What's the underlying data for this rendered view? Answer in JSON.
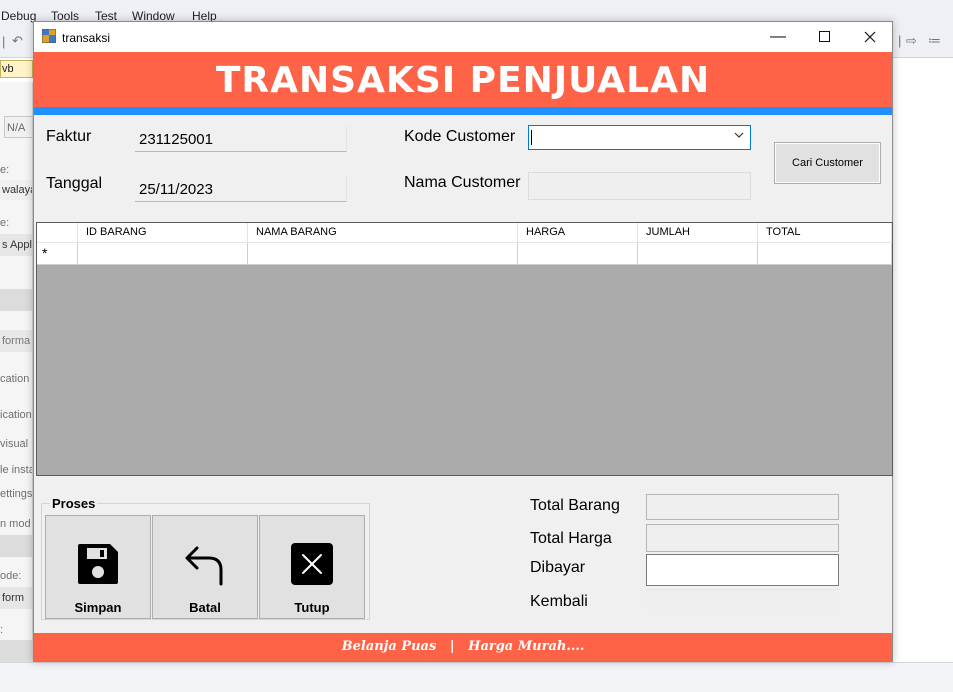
{
  "ide": {
    "menus": [
      "Debug",
      "Tools",
      "Test",
      "Window",
      "Help"
    ],
    "tab_label": "vb",
    "left_panel": {
      "na_text": "N/A",
      "label_1": "e:",
      "value_1": "walaya",
      "label_2": "e:",
      "value_2": "s Appl",
      "section": "forma",
      "item_1": "cation",
      "item_2": "ication",
      "item_3": "visual",
      "item_4": "le insta",
      "item_5": "ettings",
      "item_6": "n mod",
      "label_3": "ode:",
      "value_3": "form",
      "label_4": ":"
    }
  },
  "window": {
    "title": "transaksi",
    "header": "TRANSAKSI PENJUALAN",
    "labels": {
      "faktur": "Faktur",
      "tanggal": "Tanggal",
      "kode_customer": "Kode Customer",
      "nama_customer": "Nama Customer"
    },
    "values": {
      "faktur": "231125001",
      "tanggal": "25/11/2023",
      "kode_customer": "",
      "nama_customer": ""
    },
    "cari_button": "Cari Customer",
    "grid": {
      "columns": [
        "ID BARANG",
        "NAMA BARANG",
        "HARGA",
        "JUMLAH",
        "TOTAL"
      ],
      "new_row_marker": "*"
    },
    "proses": {
      "legend": "Proses",
      "buttons": {
        "simpan": "Simpan",
        "batal": "Batal",
        "tutup": "Tutup"
      }
    },
    "totals": {
      "total_barang_label": "Total Barang",
      "total_harga_label": "Total Harga",
      "dibayar_label": "Dibayar",
      "kembali_label": "Kembali",
      "total_barang": "",
      "total_harga": "",
      "dibayar": "",
      "kembali": ""
    },
    "footer": "Belanja Puas   |   Harga Murah....",
    "colors": {
      "accent": "#ff6347",
      "stripe": "#1e90ff",
      "grid_bg": "#ababab"
    }
  }
}
